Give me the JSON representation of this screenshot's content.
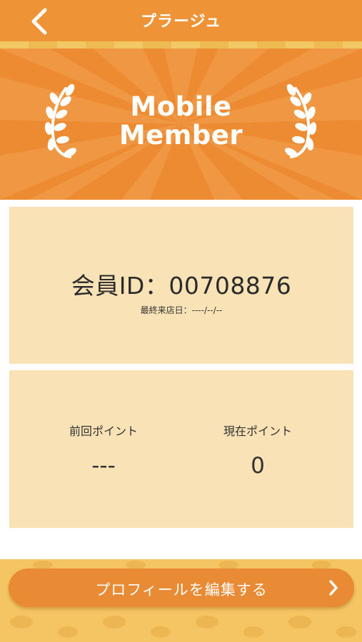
{
  "header": {
    "back_icon": "chevron-left-icon",
    "logo_text": "プラージュ"
  },
  "hero": {
    "title_line1": "Mobile",
    "title_line2": "Member",
    "icon": "laurel-icon"
  },
  "member": {
    "id_text": "会員ID：00708876",
    "last_visit_text": "最終来店日：----/--/--"
  },
  "points": {
    "previous_label": "前回ポイント",
    "previous_value": "---",
    "current_label": "現在ポイント",
    "current_value": "0"
  },
  "footer": {
    "edit_profile_label": "プロフィールを編集する",
    "chevron_icon": "chevron-right-icon"
  },
  "colors": {
    "header_orange": "#ee9436",
    "hero_orange": "#ed8b33",
    "card_cream": "#f8e2b6",
    "button_orange": "#e98a34"
  }
}
